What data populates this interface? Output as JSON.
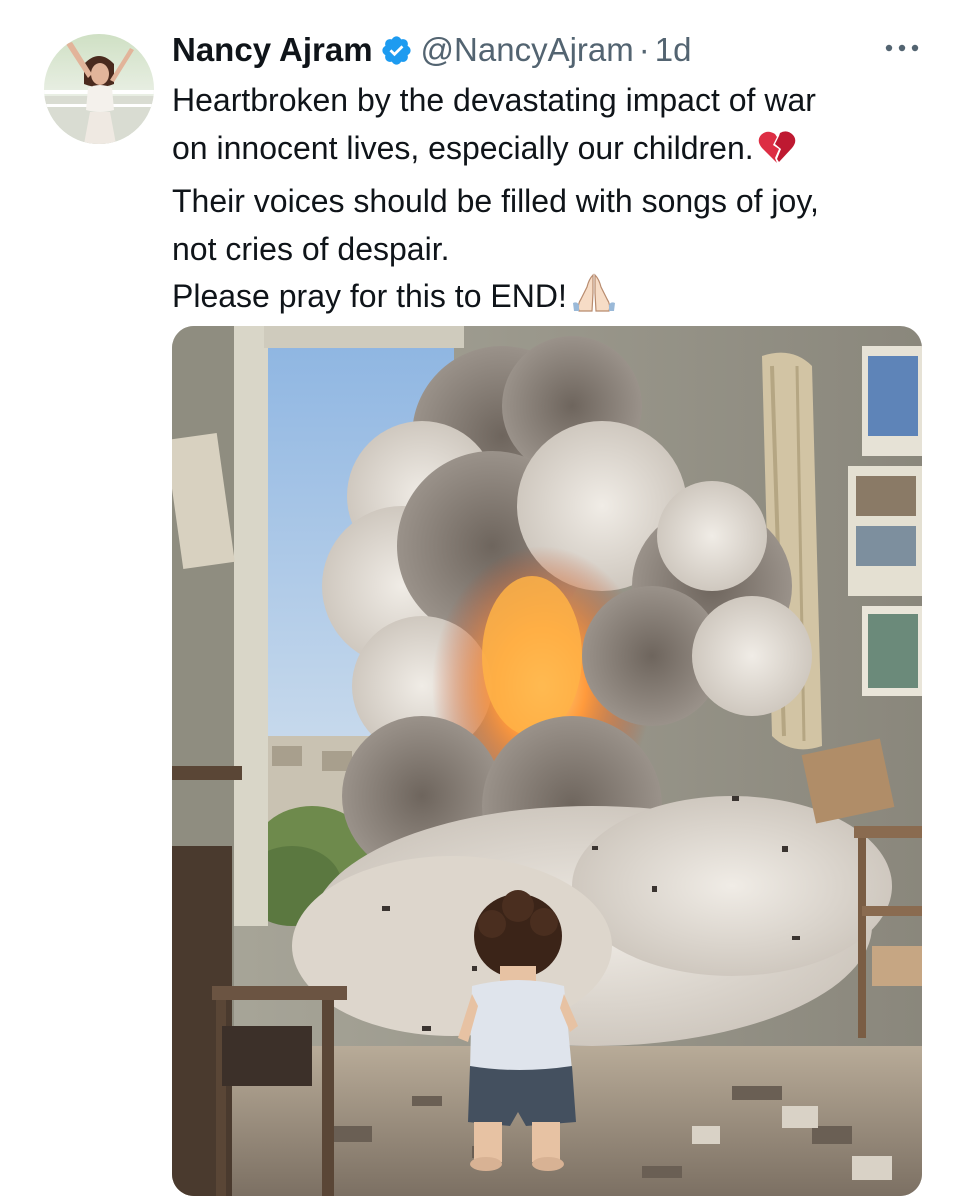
{
  "tweet": {
    "author": {
      "display_name": "Nancy Ajram",
      "handle": "@NancyAjram",
      "verified": true
    },
    "separator": "·",
    "time": "1d",
    "text_lines": [
      "Heartbroken by the devastating impact of war",
      "on innocent lives, especially our children.",
      "Their voices should be filled with songs of joy,",
      "not cries of despair.",
      "Please pray for this to END!"
    ],
    "emojis": {
      "line2": "broken-heart-icon",
      "line5": "folded-hands-icon"
    },
    "colors": {
      "verified": "#1d9bf0",
      "secondary_text": "#536471",
      "primary_text": "#0f1419"
    }
  }
}
